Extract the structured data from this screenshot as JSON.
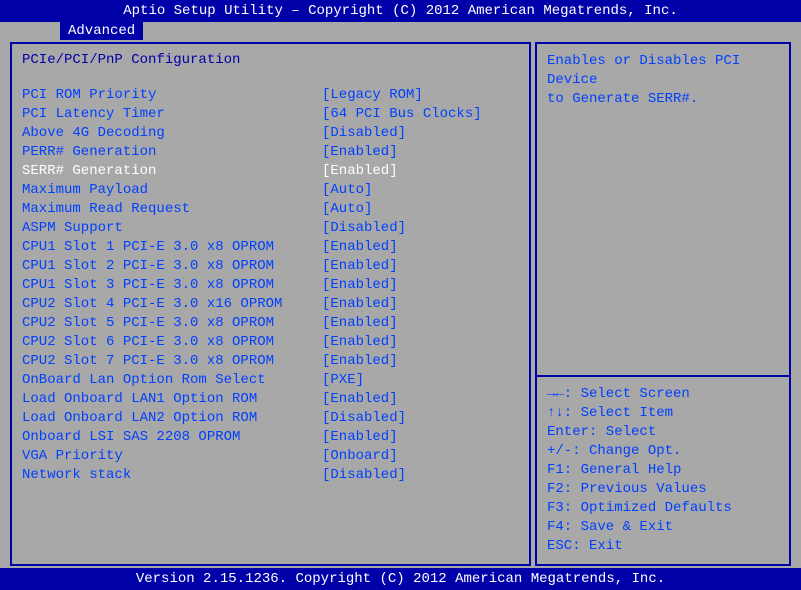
{
  "header": {
    "title": "Aptio Setup Utility – Copyright (C) 2012 American Megatrends, Inc."
  },
  "tab": {
    "label": "Advanced"
  },
  "section": {
    "title": "PCIe/PCI/PnP Configuration"
  },
  "settings": [
    {
      "label": "PCI ROM Priority",
      "value": "[Legacy ROM]",
      "selected": false
    },
    {
      "label": "PCI Latency Timer",
      "value": "[64 PCI Bus Clocks]",
      "selected": false
    },
    {
      "label": "Above 4G Decoding",
      "value": "[Disabled]",
      "selected": false
    },
    {
      "label": "PERR# Generation",
      "value": "[Enabled]",
      "selected": false
    },
    {
      "label": "SERR# Generation",
      "value": "[Enabled]",
      "selected": true
    },
    {
      "label": "Maximum Payload",
      "value": "[Auto]",
      "selected": false
    },
    {
      "label": "Maximum Read Request",
      "value": "[Auto]",
      "selected": false
    },
    {
      "label": "ASPM Support",
      "value": "[Disabled]",
      "selected": false
    },
    {
      "label": "CPU1 Slot 1 PCI-E 3.0 x8 OPROM",
      "value": "[Enabled]",
      "selected": false
    },
    {
      "label": "CPU1 Slot 2 PCI-E 3.0 x8 OPROM",
      "value": "[Enabled]",
      "selected": false
    },
    {
      "label": "CPU1 Slot 3 PCI-E 3.0 x8 OPROM",
      "value": "[Enabled]",
      "selected": false
    },
    {
      "label": "CPU2 Slot 4 PCI-E 3.0 x16 OPROM",
      "value": "[Enabled]",
      "selected": false
    },
    {
      "label": "CPU2 Slot 5 PCI-E 3.0 x8 OPROM",
      "value": "[Enabled]",
      "selected": false
    },
    {
      "label": "CPU2 Slot 6 PCI-E 3.0 x8 OPROM",
      "value": "[Enabled]",
      "selected": false
    },
    {
      "label": "CPU2 Slot 7 PCI-E 3.0 x8 OPROM",
      "value": "[Enabled]",
      "selected": false
    },
    {
      "label": "OnBoard Lan Option Rom Select",
      "value": "[PXE]",
      "selected": false
    },
    {
      "label": "Load Onboard LAN1 Option ROM",
      "value": "[Enabled]",
      "selected": false
    },
    {
      "label": "Load Onboard LAN2 Option ROM",
      "value": "[Disabled]",
      "selected": false
    },
    {
      "label": "Onboard LSI SAS 2208 OPROM",
      "value": "[Enabled]",
      "selected": false
    },
    {
      "label": "VGA Priority",
      "value": "[Onboard]",
      "selected": false
    },
    {
      "label": "Network stack",
      "value": "[Disabled]",
      "selected": false
    }
  ],
  "help": {
    "line1": "Enables or Disables PCI Device",
    "line2": "to Generate SERR#."
  },
  "keys": {
    "k1": "→←: Select Screen",
    "k2": "↑↓: Select Item",
    "k3": "Enter: Select",
    "k4": "+/-: Change Opt.",
    "k5": "F1: General Help",
    "k6": "F2: Previous Values",
    "k7": "F3: Optimized Defaults",
    "k8": "F4: Save & Exit",
    "k9": "ESC: Exit"
  },
  "footer": {
    "text": "Version 2.15.1236. Copyright (C) 2012 American Megatrends, Inc."
  }
}
